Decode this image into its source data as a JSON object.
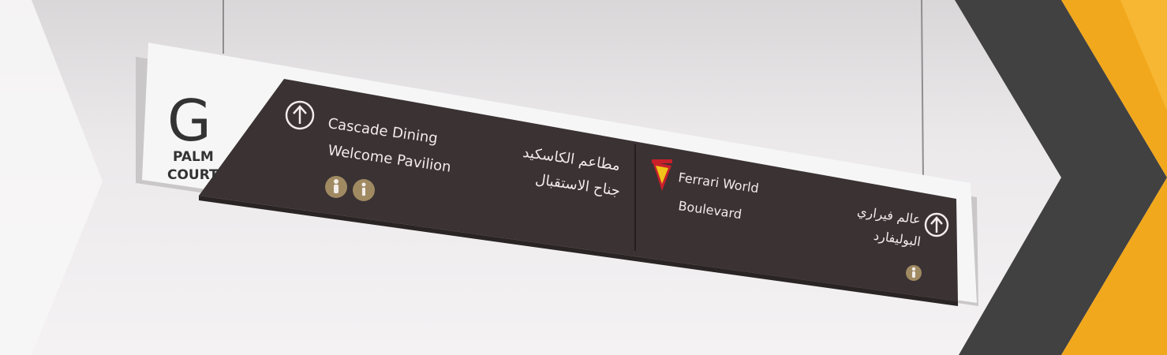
{
  "sign": {
    "level_letter": "G",
    "zone_line1": "PALM",
    "zone_line2": "COURT",
    "left_panel": {
      "en_line1": "Cascade Dining",
      "en_line2": "Welcome Pavilion",
      "ar_line1": "مطاعم الكاسكيد",
      "ar_line2": "جناح الاستقبال",
      "icons": [
        "restroom-icon",
        "info-icon"
      ],
      "arrow": "up-arrow-icon"
    },
    "right_panel": {
      "en_line1": "Ferrari World",
      "en_line2": "Boulevard",
      "ar_line1": "عالم فيراري",
      "ar_line2": "البوليفارد",
      "icons": [
        "restroom-icon"
      ],
      "arrow": "up-arrow-icon",
      "logo": "ferrari-world-logo"
    }
  },
  "colors": {
    "panel": "#3a3233",
    "frame": "#f6f6f6",
    "icon_gold": "#a08a62",
    "accent_yellow": "#f2a81d",
    "chevron_dark": "#3f3f3f"
  }
}
